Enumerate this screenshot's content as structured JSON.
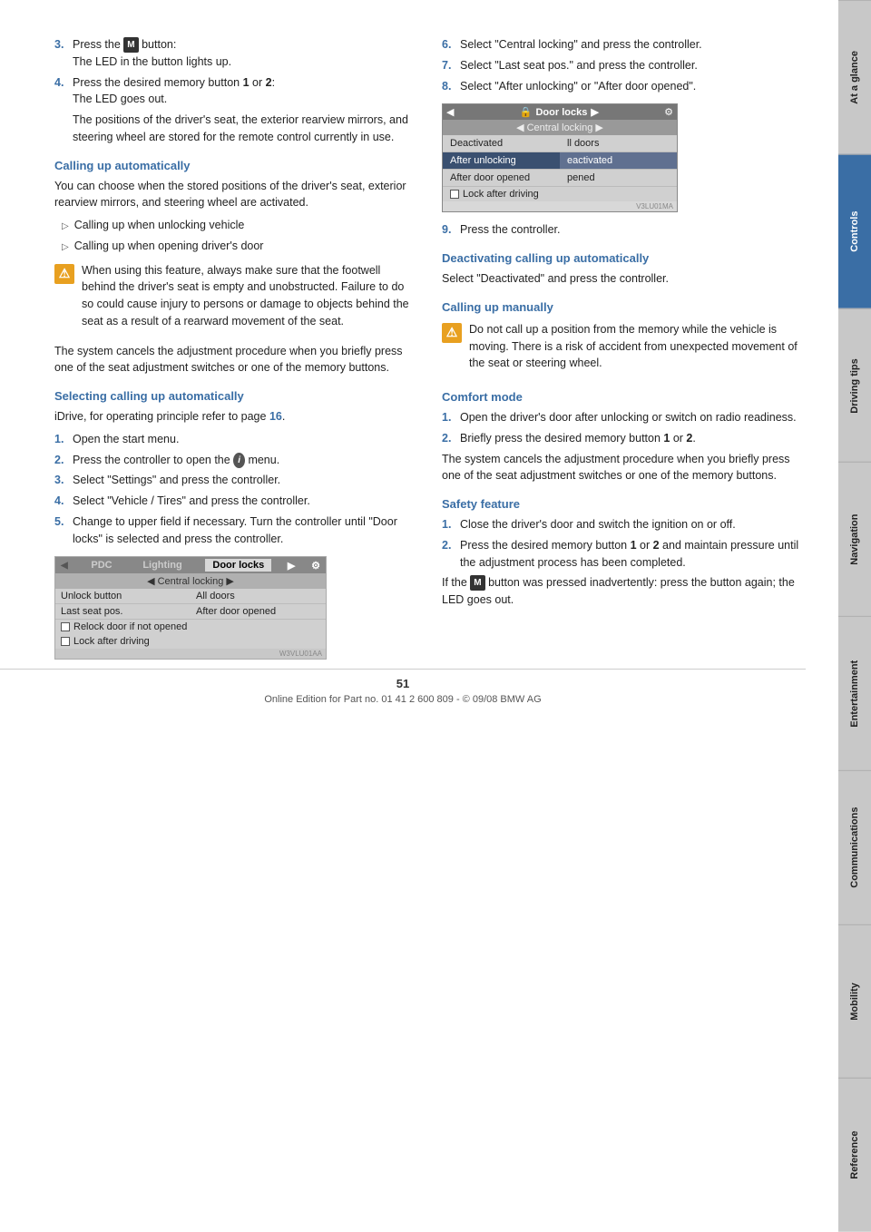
{
  "page": {
    "number": "51",
    "footer_text": "Online Edition for Part no. 01 41 2 600 809 - © 09/08 BMW AG"
  },
  "sidebar": {
    "tabs": [
      {
        "label": "At a glance",
        "active": false
      },
      {
        "label": "Controls",
        "active": true,
        "highlight": true
      },
      {
        "label": "Driving tips",
        "active": false
      },
      {
        "label": "Navigation",
        "active": false
      },
      {
        "label": "Entertainment",
        "active": false
      },
      {
        "label": "Communications",
        "active": false
      },
      {
        "label": "Mobility",
        "active": false
      },
      {
        "label": "Reference",
        "active": false
      }
    ]
  },
  "left_col": {
    "step3": {
      "num": "3.",
      "text_before": "Press the",
      "button": "M",
      "text_after": "button:",
      "sub": "The LED in the button lights up."
    },
    "step4": {
      "num": "4.",
      "text": "Press the desired memory button 1 or 2:",
      "sub": "The LED goes out."
    },
    "step4_detail": "The positions of the driver's seat, the exterior rearview mirrors, and steering wheel are stored for the remote control currently in use.",
    "calling_up_heading": "Calling up automatically",
    "calling_up_text": "You can choose when the stored positions of the driver's seat, exterior rearview mirrors, and steering wheel are activated.",
    "bullet1": "Calling up when unlocking vehicle",
    "bullet2": "Calling up when opening driver's door",
    "warning_text": "When using this feature, always make sure that the footwell behind the driver's seat is empty and unobstructed. Failure to do so could cause injury to persons or damage to objects behind the seat as a result of a rearward movement of the seat.",
    "system_cancels": "The system cancels the adjustment procedure when you briefly press one of the seat adjustment switches or one of the memory buttons.",
    "selecting_heading": "Selecting calling up automatically",
    "selecting_intro": "iDrive, for operating principle refer to page 16.",
    "sel_step1": {
      "num": "1.",
      "text": "Open the start menu."
    },
    "sel_step2": {
      "num": "2.",
      "text": "Press the controller to open the"
    },
    "sel_step2_i": "i",
    "sel_step2_end": "menu.",
    "sel_step3": {
      "num": "3.",
      "text": "Select \"Settings\" and press the controller."
    },
    "sel_step4": {
      "num": "4.",
      "text": "Select \"Vehicle / Tires\" and press the controller."
    },
    "sel_step5": {
      "num": "5.",
      "text": "Change to upper field if necessary. Turn the controller until \"Door locks\" is selected and press the controller."
    },
    "screen1": {
      "header_left": "PDC",
      "header_mid": "Lighting",
      "header_active": "Door locks",
      "header_right": "▶",
      "sub": "◀ Central locking ▶",
      "row1": {
        "left": "Unlock button",
        "right": "All doors"
      },
      "row2": {
        "left": "Last seat pos.",
        "right": "After door opened"
      },
      "row3": "Relock door if not opened",
      "row4": "Lock after driving",
      "watermark": "W3VLU01AA"
    }
  },
  "right_col": {
    "step6": {
      "num": "6.",
      "text": "Select \"Central locking\" and press the controller."
    },
    "step7": {
      "num": "7.",
      "text": "Select \"Last seat pos.\" and press the controller."
    },
    "step8": {
      "num": "8.",
      "text": "Select \"After unlocking\" or \"After door opened\"."
    },
    "doorlocks_screen": {
      "header": "Door locks",
      "sub": "◀ Central locking ▶",
      "row1": {
        "left": "Deactivated",
        "right": "ll doors"
      },
      "row2": {
        "left": "After unlocking",
        "right": "eactivated",
        "selected": true
      },
      "row3": {
        "left": "After door opened",
        "right": "pened"
      },
      "row4": "Lock after driving",
      "watermark": "V3LU01MA"
    },
    "step9": {
      "num": "9.",
      "text": "Press the controller."
    },
    "deactivating_heading": "Deactivating calling up automatically",
    "deactivating_text": "Select \"Deactivated\" and press the controller.",
    "calling_manually_heading": "Calling up manually",
    "calling_manually_warning": "Do not call up a position from the memory while the vehicle is moving. There is a risk of accident from unexpected movement of the seat or steering wheel.",
    "comfort_heading": "Comfort mode",
    "comfort_step1": {
      "num": "1.",
      "text": "Open the driver's door after unlocking or switch on radio readiness."
    },
    "comfort_step2": {
      "num": "2.",
      "text": "Briefly press the desired memory button 1 or 2."
    },
    "comfort_system_cancels": "The system cancels the adjustment procedure when you briefly press one of the seat adjustment switches or one of the memory buttons.",
    "safety_heading": "Safety feature",
    "safety_step1": {
      "num": "1.",
      "text": "Close the driver's door and switch the ignition on or off."
    },
    "safety_step2": {
      "num": "2.",
      "text": "Press the desired memory button 1 or 2 and maintain pressure until the adjustment process has been completed."
    },
    "safety_footer_before": "If the",
    "safety_footer_button": "M",
    "safety_footer_after": "button was pressed inadvertently: press the button again; the LED goes out."
  }
}
